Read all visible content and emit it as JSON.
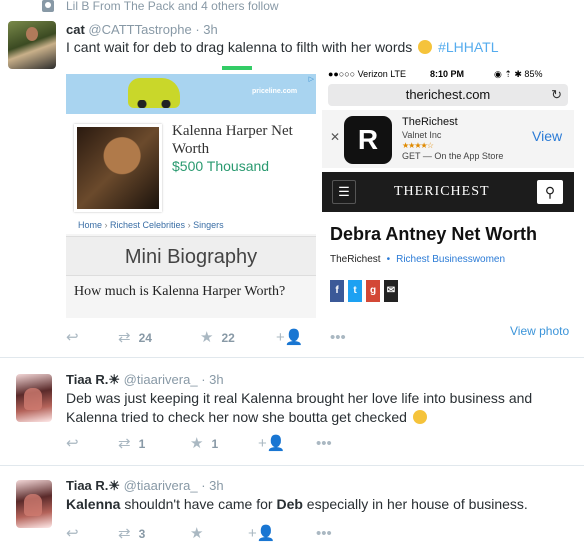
{
  "context": {
    "text": "Lil B From The Pack and 4 others follow"
  },
  "tweets": [
    {
      "name": "cat",
      "handle": "@CATTTastrophe",
      "time": "· 3h",
      "text_before": "I cant wait for deb to drag kalenna to filth with her words",
      "hashtag": "#LHHATL",
      "retweets": "24",
      "favorites": "22",
      "view_photo": "View photo"
    },
    {
      "name": "Tiaa R.☀",
      "handle": "@tiaarivera_",
      "time": "· 3h",
      "text_line1": "Deb was just keeping it real Kalenna brought her love life into business and",
      "text_line2": "Kalenna tried to check her now she boutta get checked",
      "retweets": "1",
      "favorites": "1"
    },
    {
      "name": "Tiaa R.☀",
      "handle": "@tiaarivera_",
      "time": "· 3h",
      "text_b1": "Kalenna",
      "text_m1": "shouldn't have came for",
      "text_b2": "Deb",
      "text_m2": "especially in her house of business.",
      "retweets": "3",
      "favorites": ""
    }
  ],
  "media_left": {
    "ad_brand": "priceline.com",
    "person_title": "Kalenna Harper Net Worth",
    "price": "$500 Thousand",
    "crumb_home": "Home",
    "crumb_cat": "Richest Celebrities",
    "crumb_sub": "Singers",
    "section": "Mini Biography",
    "question": "How much is Kalenna Harper Worth?"
  },
  "media_right": {
    "carrier": "●●○○○ Verizon  LTE",
    "time": "8:10 PM",
    "battery": "◉ ⇡ ✱ 85%",
    "url": "therichest.com",
    "app_name": "TheRichest",
    "app_publisher": "Valnet Inc",
    "app_stars": "★★★★☆",
    "app_get": "GET — On the App Store",
    "app_view": "View",
    "site_logo": "THERICHEST",
    "article_title": "Debra Antney Net Worth",
    "source": "TheRichest",
    "category": "Richest Businesswomen"
  },
  "icons": {
    "reply": "↩",
    "retweet": "⇄",
    "favorite": "★",
    "follow": "+👤",
    "more": "•••"
  }
}
